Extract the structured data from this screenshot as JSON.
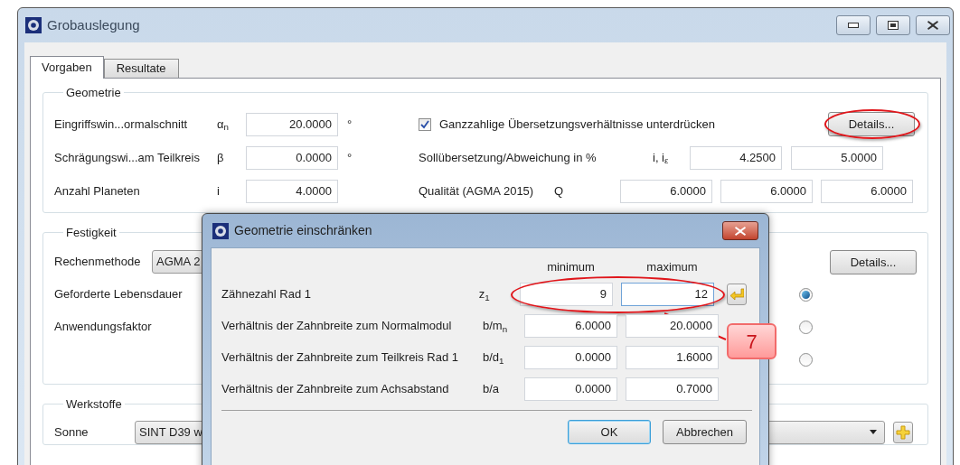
{
  "window": {
    "title": "Grobauslegung"
  },
  "tabs": [
    {
      "label": "Vorgaben",
      "selected": true
    },
    {
      "label": "Resultate",
      "selected": false
    }
  ],
  "geometrie": {
    "title": "Geometrie",
    "rows": [
      {
        "label": "Eingriffswin...ormalschnitt",
        "symbol": "α$_{n}$",
        "value": "20.0000",
        "unit": "°"
      },
      {
        "label": "Schrägungswi...am Teilkreis",
        "symbol": "β",
        "value": "0.0000",
        "unit": "°"
      },
      {
        "label": "Anzahl Planeten",
        "symbol": "i",
        "value": "4.0000"
      }
    ],
    "checkbox": {
      "label": "Ganzzahlige Übersetzungsverhältnisse unterdrücken",
      "checked": true
    },
    "details_button": {
      "label": "Details...",
      "highlighted": true
    },
    "ratio": {
      "label": "Sollübersetzung/Abweichung in %",
      "symbol": "i, i$_{ε}$",
      "values": [
        "4.2500",
        "5.0000"
      ]
    },
    "quality": {
      "label": "Qualität (AGMA 2015)",
      "symbol": "Q",
      "values": [
        "6.0000",
        "6.0000",
        "6.0000"
      ]
    }
  },
  "festigkeit": {
    "title": "Festigkeit",
    "method_label": "Rechenmethode",
    "method_value": "AGMA 2",
    "labels": [
      "Geforderte Lebensdauer",
      "Anwendungsfaktor"
    ],
    "details_button": {
      "label": "Details...",
      "highlighted": false
    },
    "radios": [
      {
        "selected": true
      },
      {
        "selected": false
      },
      {
        "selected": false
      }
    ]
  },
  "werkstoffe": {
    "title": "Werkstoffe",
    "rows": [
      {
        "label": "Sonne",
        "value": "SINT D39 w"
      }
    ]
  },
  "dialog": {
    "title": "Geometrie einschränken",
    "columns": [
      "minimum",
      "maximum"
    ],
    "rows": [
      {
        "label": "Zähnezahl Rad 1",
        "symbol": "z$_{1}$",
        "min": "9",
        "max": "12",
        "apply_button": true,
        "highlighted": true
      },
      {
        "label": "Verhältnis der Zahnbreite zum Normalmodul",
        "symbol": "b/m$_{n}$",
        "min": "6.0000",
        "max": "20.0000",
        "apply_button": false,
        "highlighted": false
      },
      {
        "label": "Verhältnis der Zahnbreite zum Teilkreis Rad 1",
        "symbol": "b/d$_{1}$",
        "min": "0.0000",
        "max": "1.6000",
        "apply_button": false,
        "highlighted": false
      },
      {
        "label": "Verhältnis der Zahnbreite zum Achsabstand",
        "symbol": "b/a",
        "min": "0.0000",
        "max": "0.7000",
        "apply_button": false,
        "highlighted": false
      }
    ],
    "buttons": [
      {
        "label": "OK",
        "default": true
      },
      {
        "label": "Abbrechen",
        "default": false
      }
    ]
  },
  "annotation": {
    "callout": "7"
  }
}
